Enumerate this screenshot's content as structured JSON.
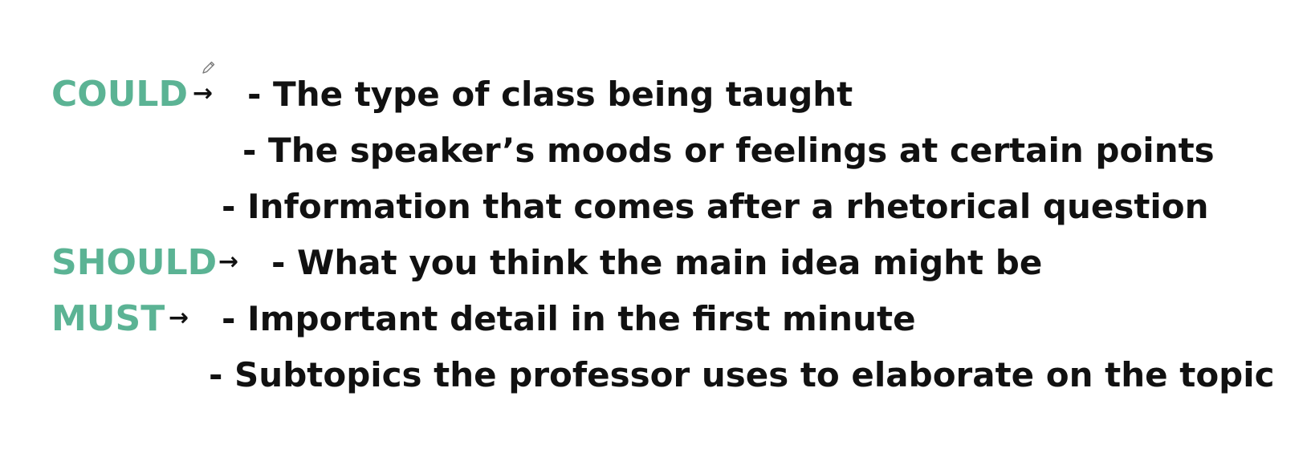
{
  "rows": [
    {
      "keyword": "COULD",
      "items": [
        "- The type of class being taught",
        "- The speaker’s moods or feelings at certain points",
        "- Information that comes after a rhetorical question"
      ]
    },
    {
      "keyword": "SHOULD",
      "items": [
        "- What you think the main idea might be"
      ]
    },
    {
      "keyword": "MUST",
      "items": [
        "- Important detail in the first minute",
        "- Subtopics the professor uses to elaborate on the topic"
      ]
    }
  ],
  "arrow_glyph": "→",
  "colors": {
    "keyword": "#5bb394",
    "text": "#111111",
    "background": "#ffffff"
  },
  "icons": {
    "cursor": "pencil-icon"
  }
}
